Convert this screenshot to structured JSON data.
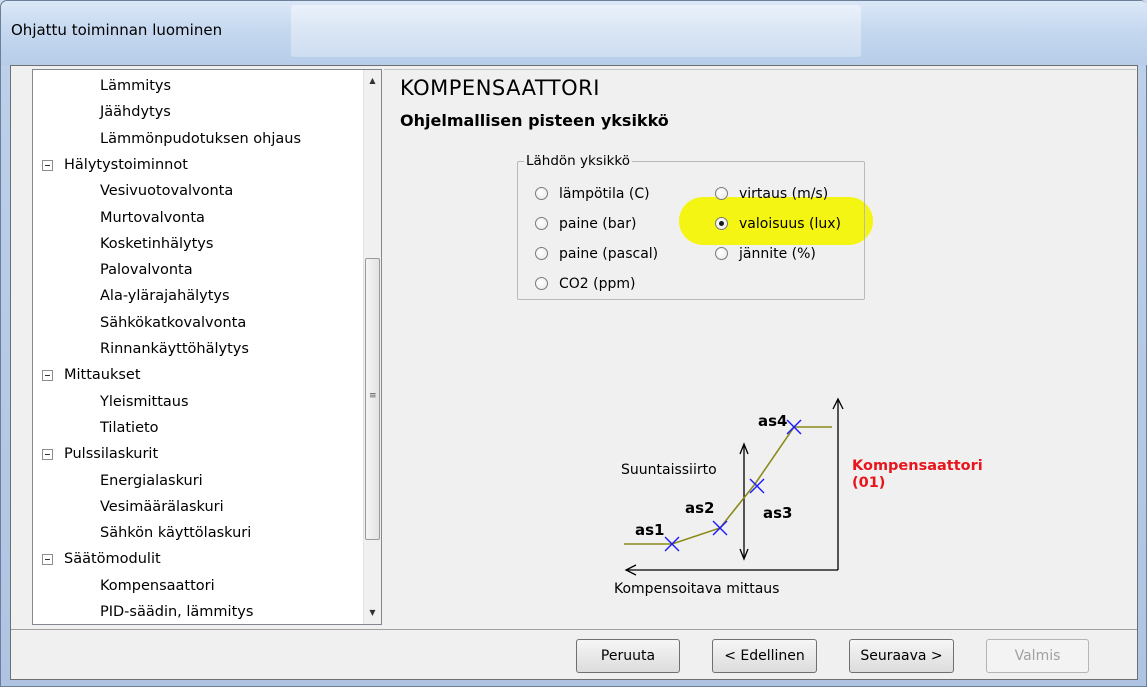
{
  "window": {
    "title": "Ohjattu toiminnan luominen"
  },
  "tree": {
    "items": [
      {
        "label": "Lämmitys",
        "type": "child"
      },
      {
        "label": "Jäähdytys",
        "type": "child"
      },
      {
        "label": "Lämmönpudotuksen ohjaus",
        "type": "child"
      },
      {
        "label": "Hälytystoiminnot",
        "type": "group"
      },
      {
        "label": "Vesivuotovalvonta",
        "type": "child"
      },
      {
        "label": "Murtovalvonta",
        "type": "child"
      },
      {
        "label": "Kosketinhälytys",
        "type": "child"
      },
      {
        "label": "Palovalvonta",
        "type": "child"
      },
      {
        "label": "Ala-ylärajahälytys",
        "type": "child"
      },
      {
        "label": "Sähkökatkovalvonta",
        "type": "child"
      },
      {
        "label": "Rinnankäyttöhälytys",
        "type": "child"
      },
      {
        "label": "Mittaukset",
        "type": "group"
      },
      {
        "label": "Yleismittaus",
        "type": "child"
      },
      {
        "label": "Tilatieto",
        "type": "child"
      },
      {
        "label": "Pulssilaskurit",
        "type": "group"
      },
      {
        "label": "Energialaskuri",
        "type": "child"
      },
      {
        "label": "Vesimäärälaskuri",
        "type": "child"
      },
      {
        "label": "Sähkön käyttölaskuri",
        "type": "child"
      },
      {
        "label": "Säätömodulit",
        "type": "group"
      },
      {
        "label": "Kompensaattori",
        "type": "child"
      },
      {
        "label": "PID-säädin, lämmitys",
        "type": "child"
      }
    ]
  },
  "panel": {
    "heading": "KOMPENSAATTORI",
    "subheading": "Ohjelmallisen pisteen yksikkö",
    "unit_group": {
      "label": "Lähdön yksikkö",
      "options": [
        {
          "label": "lämpötila (C)",
          "checked": false
        },
        {
          "label": "paine (bar)",
          "checked": false
        },
        {
          "label": "paine (pascal)",
          "checked": false
        },
        {
          "label": "CO2 (ppm)",
          "checked": false
        },
        {
          "label": "virtaus (m/s)",
          "checked": false
        },
        {
          "label": "valoisuus (lux)",
          "checked": true
        },
        {
          "label": "jännite (%)",
          "checked": false
        }
      ],
      "highlight_color": "#f5f500"
    },
    "diagram": {
      "offset_label": "Suuntaissiirto",
      "x_label": "Kompensoitava mittaus",
      "output_label_line1": "Kompensaattori",
      "output_label_line2": "(01)",
      "point_labels": [
        "as1",
        "as2",
        "as3",
        "as4"
      ],
      "output_color": "#e8161c",
      "curve_color": "#8a8a1a",
      "marker_color": "#1a1aff"
    }
  },
  "buttons": {
    "cancel": "Peruuta",
    "back": "< Edellinen",
    "next": "Seuraava >",
    "finish": "Valmis"
  }
}
